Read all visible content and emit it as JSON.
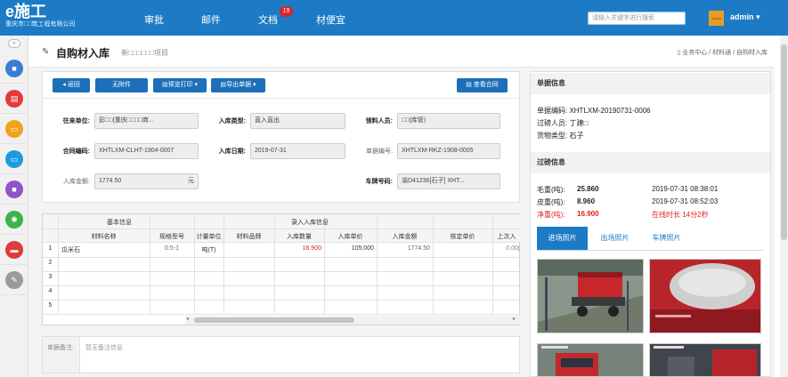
{
  "topbar": {
    "logo_main": "e施工",
    "logo_sub": "重庆市□□筑工程有限公司",
    "nav": [
      "审批",
      "邮件",
      "文档",
      "材便宜"
    ],
    "doc_badge": "19",
    "search_placeholder": "请输入关键字进行搜索",
    "avatar_text": "admin",
    "user": "admin ▾"
  },
  "sidebar": {
    "toggle": "»",
    "icons": [
      {
        "name": "briefcase-icon",
        "color": "#3a7fd5",
        "glyph": "■"
      },
      {
        "name": "document-icon",
        "color": "#e53a3a",
        "glyph": "▤"
      },
      {
        "name": "folder-icon",
        "color": "#f3a21b",
        "glyph": "▭"
      },
      {
        "name": "folder-blue-icon",
        "color": "#1e9be0",
        "glyph": "▭"
      },
      {
        "name": "package-icon",
        "color": "#8e54c9",
        "glyph": "■"
      },
      {
        "name": "gear-icon",
        "color": "#3fb24b",
        "glyph": "✺"
      },
      {
        "name": "book-icon",
        "color": "#e03a3a",
        "glyph": "▬"
      },
      {
        "name": "wrench-icon",
        "color": "#9a9a9a",
        "glyph": "✎"
      }
    ]
  },
  "header": {
    "title": "自购材入库",
    "subtitle": "新□□□□□□项目",
    "breadcrumb": "业务中心 / 材料通 / 自购材入库"
  },
  "toolbar": {
    "back": "◂ 返回",
    "attachment": "无附件",
    "print": "▤预览打印 ▾",
    "export": "▤导出单据 ▾",
    "contract": "▤ 查看合同"
  },
  "form": {
    "from_unit_label": "往来单位:",
    "from_unit": "彭□□(重庆□□□□商...",
    "type_label": "入库类型:",
    "type": "直入直出",
    "picker_label": "领料人员:",
    "picker": "□□(库管)",
    "contract_label": "合同编码:",
    "contract": "XHTLXM-CLHT-1904-0007",
    "date_label": "入库日期:",
    "date": "2019-07-31",
    "doc_no_label": "单据编号:",
    "doc_no": "XHTLXM-RKZ-1908-0005",
    "amount_label": "入库金额:",
    "amount": "1774.50",
    "amount_unit": "元",
    "plate_label": "车牌号码:",
    "plate": "渝D41236[石子] XHT..."
  },
  "grid": {
    "group_basic": "基本信息",
    "group_entry": "录入入库信息",
    "headers": [
      "材料名称",
      "规格型号",
      "计量单位",
      "材料品牌",
      "入库数量",
      "入库单价",
      "入库金额",
      "核定单价",
      "上次入"
    ],
    "rows": [
      {
        "no": "1",
        "name": "瓜米石",
        "spec": "0.5-1",
        "unit": "吨(T)",
        "brand": "",
        "qty": "16.900",
        "price": "105.000",
        "total": "1774.50",
        "check": "",
        "last": "0.00("
      },
      {
        "no": "2"
      },
      {
        "no": "3"
      },
      {
        "no": "4"
      },
      {
        "no": "5"
      }
    ]
  },
  "remark": {
    "label": "单据备注:",
    "value": "暂无备注信息"
  },
  "doc_info": {
    "heading": "单据信息",
    "code": "单据编码: XHTLXM-20190731-0006",
    "weigher": "过磅人员: 丁建□",
    "cargo": "货物类型: 石子"
  },
  "weigh_info": {
    "heading": "过磅信息",
    "gross_label": "毛重(吨):",
    "gross": "25.860",
    "gross_time": "2019-07-31 08:38:01",
    "tare_label": "皮重(吨):",
    "tare": "8.960",
    "tare_time": "2019-07-31 08:52:03",
    "net_label": "净重(吨):",
    "net": "16.900",
    "online": "在线时长 14分2秒"
  },
  "photo_tabs": [
    "进场照片",
    "出场照片",
    "车牌照片"
  ],
  "photos": [
    {
      "name": "photo-entry-1"
    },
    {
      "name": "photo-entry-2"
    },
    {
      "name": "photo-entry-3"
    },
    {
      "name": "photo-entry-4"
    }
  ],
  "colors": {
    "brand": "#1c7bc4",
    "button": "#1c6fb8",
    "red": "#e02020"
  }
}
